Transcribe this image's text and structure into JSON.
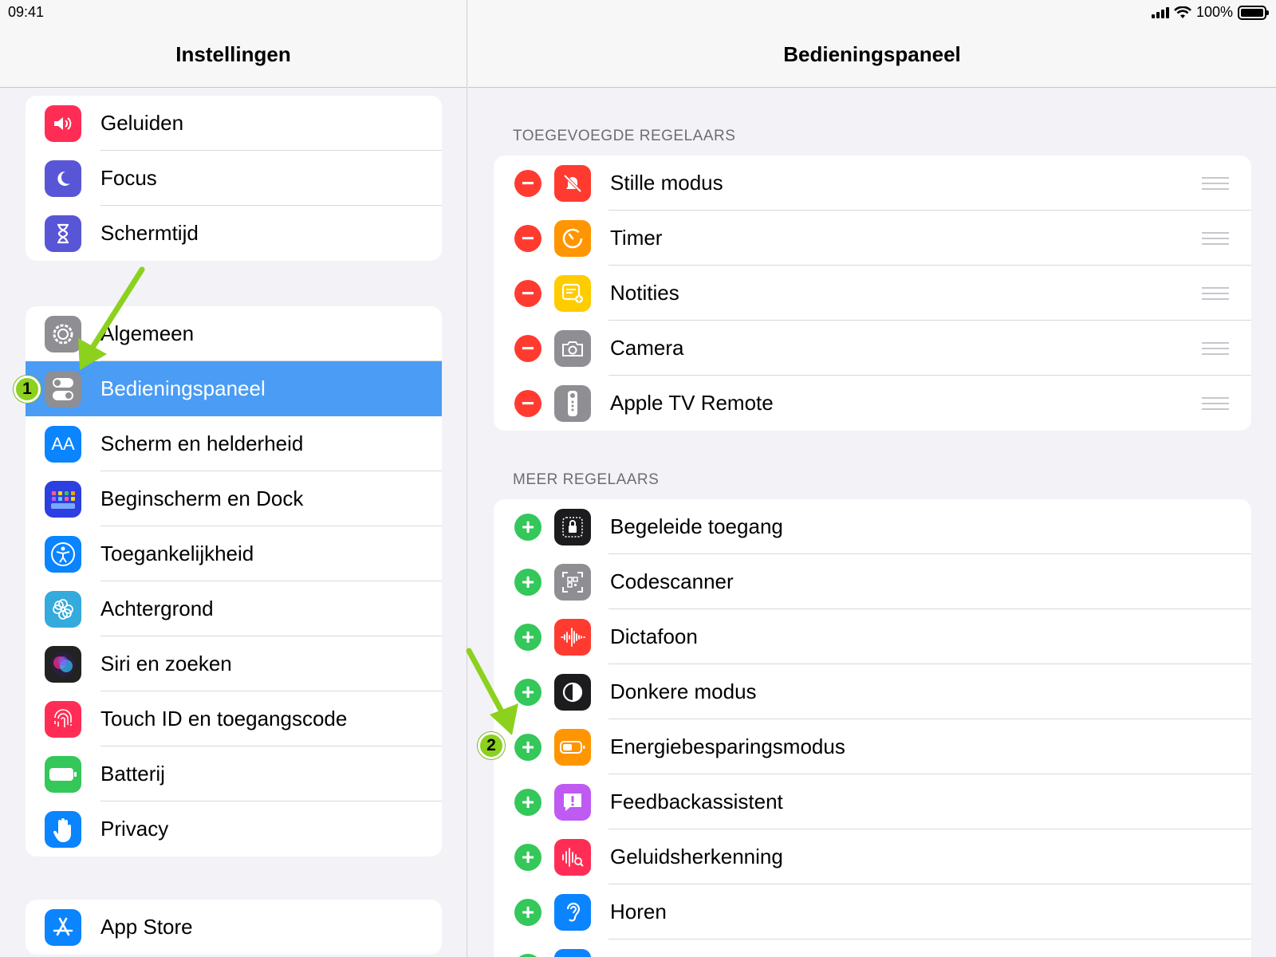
{
  "status": {
    "time": "09:41",
    "battery": "100%"
  },
  "sidebar": {
    "title": "Instellingen",
    "group1": [
      {
        "label": "Geluiden",
        "icon": "speaker-icon",
        "color": "#ff2d55"
      },
      {
        "label": "Focus",
        "icon": "moon-icon",
        "color": "#5856d6"
      },
      {
        "label": "Schermtijd",
        "icon": "hourglass-icon",
        "color": "#5856d6"
      }
    ],
    "group2": [
      {
        "label": "Algemeen",
        "icon": "gear-icon",
        "color": "#8e8e93"
      },
      {
        "label": "Bedieningspaneel",
        "icon": "toggles-icon",
        "color": "#8e8e93"
      },
      {
        "label": "Scherm en helderheid",
        "icon": "text-size-icon",
        "color": "#0a84ff"
      },
      {
        "label": "Beginscherm en Dock",
        "icon": "grid-icon",
        "color": "#2c3fe0"
      },
      {
        "label": "Toegankelijkheid",
        "icon": "accessibility-icon",
        "color": "#0a84ff"
      },
      {
        "label": "Achtergrond",
        "icon": "flower-icon",
        "color": "#35aadc"
      },
      {
        "label": "Siri en zoeken",
        "icon": "siri-icon",
        "color": "#222222"
      },
      {
        "label": "Touch ID en toegangscode",
        "icon": "fingerprint-icon",
        "color": "#ff2d55"
      },
      {
        "label": "Batterij",
        "icon": "battery-icon",
        "color": "#34c759"
      },
      {
        "label": "Privacy",
        "icon": "hand-icon",
        "color": "#0a84ff"
      }
    ],
    "group3": [
      {
        "label": "App Store",
        "icon": "appstore-icon",
        "color": "#0a84ff"
      }
    ]
  },
  "detail": {
    "title": "Bedieningspaneel",
    "added_header": "TOEGEVOEGDE REGELAARS",
    "added": [
      {
        "label": "Stille modus",
        "icon": "bell-slash-icon",
        "color": "#ff3b30"
      },
      {
        "label": "Timer",
        "icon": "timer-icon",
        "color": "#ff9500"
      },
      {
        "label": "Notities",
        "icon": "notes-icon",
        "color": "#ffcc00"
      },
      {
        "label": "Camera",
        "icon": "camera-icon",
        "color": "#8e8e93"
      },
      {
        "label": "Apple TV Remote",
        "icon": "remote-icon",
        "color": "#8e8e93"
      }
    ],
    "more_header": "MEER REGELAARS",
    "more": [
      {
        "label": "Begeleide toegang",
        "icon": "lock-icon",
        "color": "#1c1c1e"
      },
      {
        "label": "Codescanner",
        "icon": "qr-icon",
        "color": "#8e8e93"
      },
      {
        "label": "Dictafoon",
        "icon": "waveform-icon",
        "color": "#ff3b30"
      },
      {
        "label": "Donkere modus",
        "icon": "contrast-icon",
        "color": "#1c1c1e"
      },
      {
        "label": "Energiebesparingsmodus",
        "icon": "battery-low-icon",
        "color": "#ff9500"
      },
      {
        "label": "Feedbackassistent",
        "icon": "feedback-icon",
        "color": "#bf5af2"
      },
      {
        "label": "Geluidsherkenning",
        "icon": "sound-search-icon",
        "color": "#ff2d55"
      },
      {
        "label": "Horen",
        "icon": "ear-icon",
        "color": "#0a84ff"
      }
    ]
  },
  "annotations": {
    "badge1": "1",
    "badge2": "2"
  }
}
